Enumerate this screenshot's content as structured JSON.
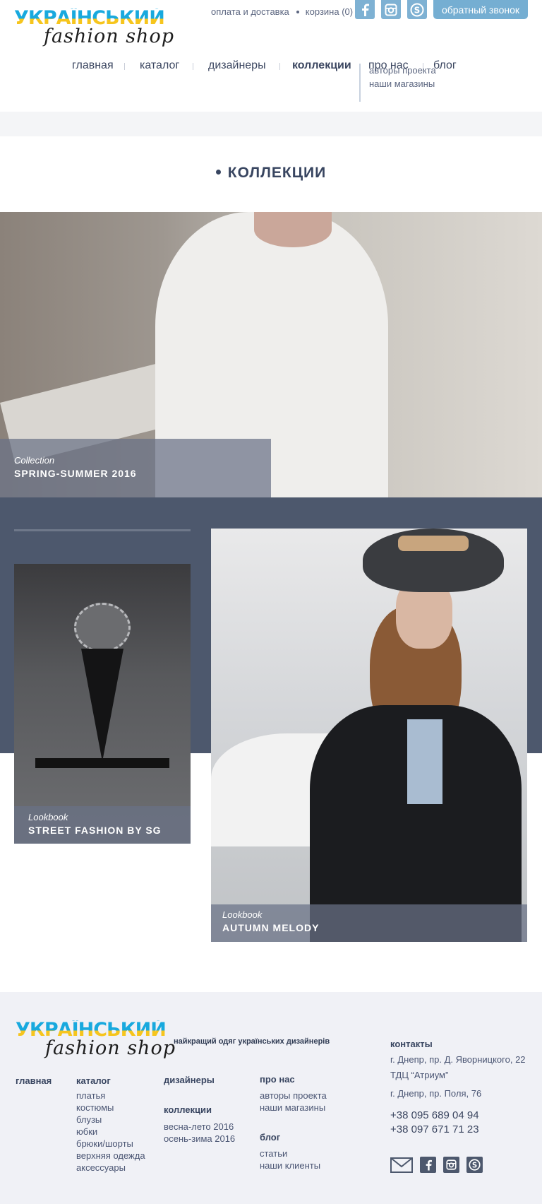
{
  "logo": {
    "line1": "УКРАЇНСЬКИЙ",
    "line2": "fashion shop"
  },
  "top_links": {
    "delivery": "оплата и доставка",
    "cart": "корзина (0)"
  },
  "social_icons": [
    "facebook-icon",
    "instagram-icon",
    "skype-icon"
  ],
  "callback_label": "обратный звонок",
  "nav": {
    "items": [
      "главная",
      "каталог",
      "дизайнеры",
      "коллекции",
      "про нас",
      "блог"
    ],
    "active": "коллекции",
    "sub_items": [
      "авторы проекта",
      "наши магазины"
    ]
  },
  "page_title": "КОЛЛЕКЦИИ",
  "colors": {
    "accent": "#75aed2",
    "dark_band": "#4d586d",
    "text": "#3b4660",
    "footer_bg": "#f0f1f6"
  },
  "collections": [
    {
      "type": "Collection",
      "title": "SPRING-SUMMER 2016"
    },
    {
      "type": "Lookbook",
      "title": "STREET FASHION BY SG"
    },
    {
      "type": "Lookbook",
      "title": "AUTUMN MELODY"
    }
  ],
  "footer": {
    "tagline": "найкращий одяг українських дизайнерів",
    "home": "главная",
    "catalog": {
      "title": "каталог",
      "items": [
        "платья",
        "костюмы",
        "блузы",
        "юбки",
        "брюки/шорты",
        "верхняя одежда",
        "аксессуары"
      ]
    },
    "designers": "дизайнеры",
    "collections": {
      "title": "коллекции",
      "items": [
        "весна-лето 2016",
        "осень-зима 2016"
      ]
    },
    "about": {
      "title": "про нас",
      "items": [
        "авторы проекта",
        "наши магазины"
      ]
    },
    "blog": {
      "title": "блог",
      "items": [
        "статьи",
        "наши клиенты"
      ]
    },
    "contacts": {
      "title": "контакты",
      "address1": "г. Днепр, пр. Д. Яворницкого, 22",
      "address1b": "ТДЦ “Атриум”",
      "address2": "г. Днепр, пр. Поля, 76",
      "phone1": "+38 095 689 04 94",
      "phone2": "+38 097 671 71 23"
    },
    "social_icons": [
      "mail-icon",
      "facebook-icon",
      "instagram-icon",
      "skype-icon"
    ]
  }
}
